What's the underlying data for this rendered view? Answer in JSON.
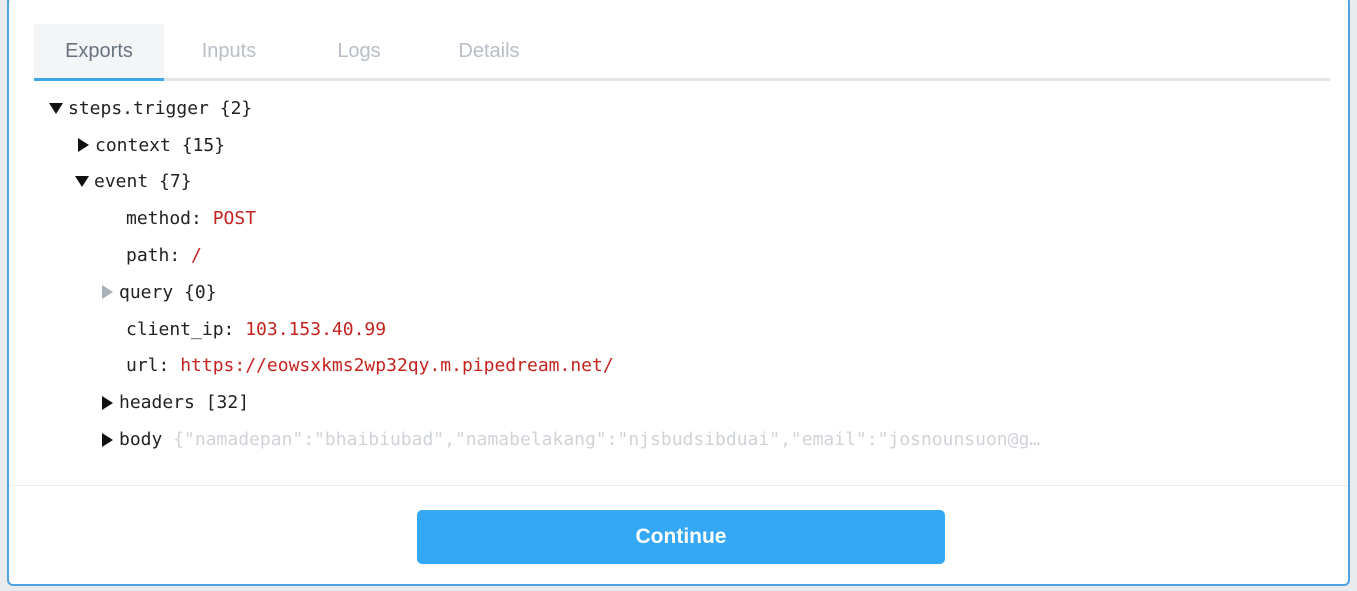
{
  "tabs": [
    {
      "label": "Exports",
      "active": true
    },
    {
      "label": "Inputs",
      "active": false
    },
    {
      "label": "Logs",
      "active": false
    },
    {
      "label": "Details",
      "active": false
    }
  ],
  "tree": {
    "root": {
      "key": "steps.trigger",
      "count": "{2}"
    },
    "context": {
      "key": "context",
      "count": "{15}"
    },
    "event": {
      "key": "event",
      "count": "{7}"
    },
    "method": {
      "key": "method:",
      "value": "POST"
    },
    "path": {
      "key": "path:",
      "value": "/"
    },
    "query": {
      "key": "query",
      "count": "{0}"
    },
    "client_ip": {
      "key": "client_ip:",
      "value": "103.153.40.99"
    },
    "url": {
      "key": "url:",
      "value": "https://eowsxkms2wp32qy.m.pipedream.net/"
    },
    "headers": {
      "key": "headers",
      "count": "[32]"
    },
    "body": {
      "key": "body",
      "preview": "{\"namadepan\":\"bhaibiubad\",\"namabelakang\":\"njsbudsibduai\",\"email\":\"josnounsuon@g…"
    }
  },
  "footer": {
    "continue_label": "Continue"
  },
  "colors": {
    "accent": "#34a8f5",
    "value_red": "#c4231e"
  }
}
